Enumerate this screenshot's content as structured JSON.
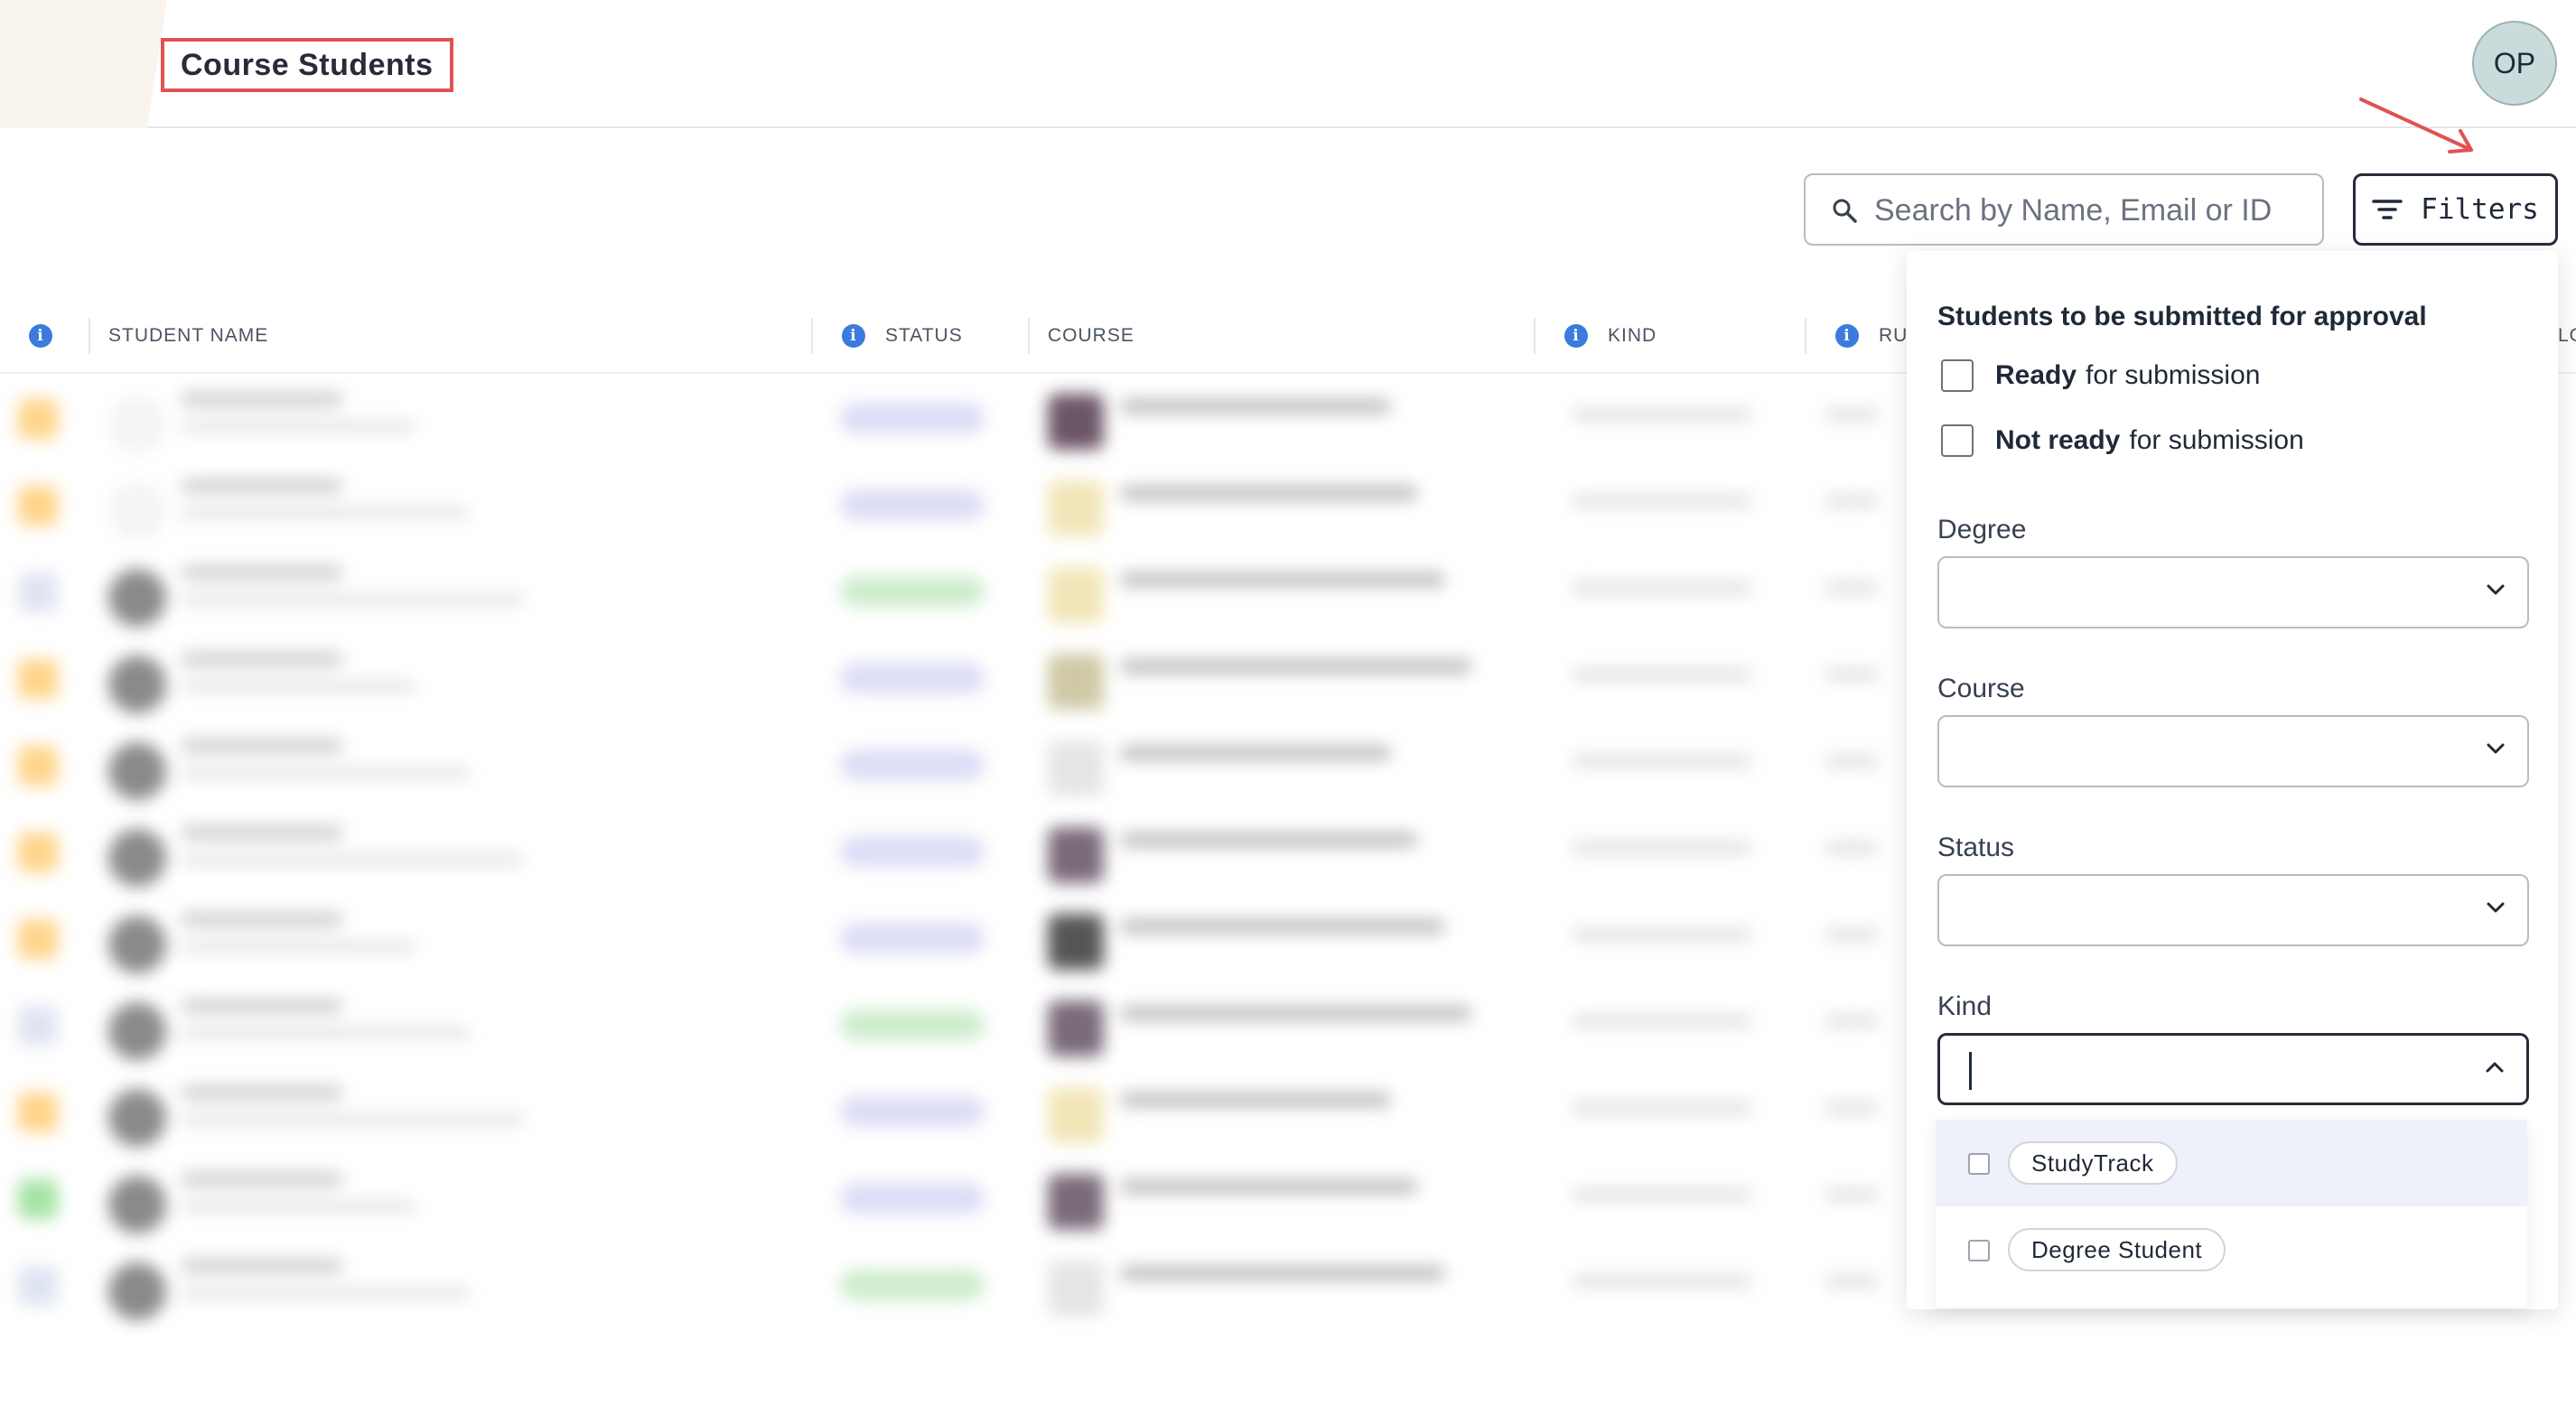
{
  "header": {
    "title": "Course Students",
    "avatar_initials": "OP"
  },
  "toolbar": {
    "search_placeholder": "Search by Name, Email or ID",
    "filters_label": "Filters"
  },
  "table": {
    "columns": [
      "STUDENT NAME",
      "STATUS",
      "COURSE",
      "KIND",
      "RU",
      "LO"
    ]
  },
  "filters_panel": {
    "section_title": "Students to be submitted for approval",
    "checkboxes": [
      {
        "bold": "Ready",
        "rest": "for submission"
      },
      {
        "bold": "Not ready",
        "rest": "for submission"
      }
    ],
    "fields": [
      {
        "label": "Degree",
        "value": ""
      },
      {
        "label": "Course",
        "value": ""
      },
      {
        "label": "Status",
        "value": ""
      },
      {
        "label": "Kind",
        "value": ""
      }
    ],
    "kind_options": [
      "StudyTrack",
      "Degree Student"
    ]
  },
  "colors": {
    "annotation_red": "#e05252",
    "info_blue": "#3b7bdc",
    "highlight": "#eef1fa"
  }
}
